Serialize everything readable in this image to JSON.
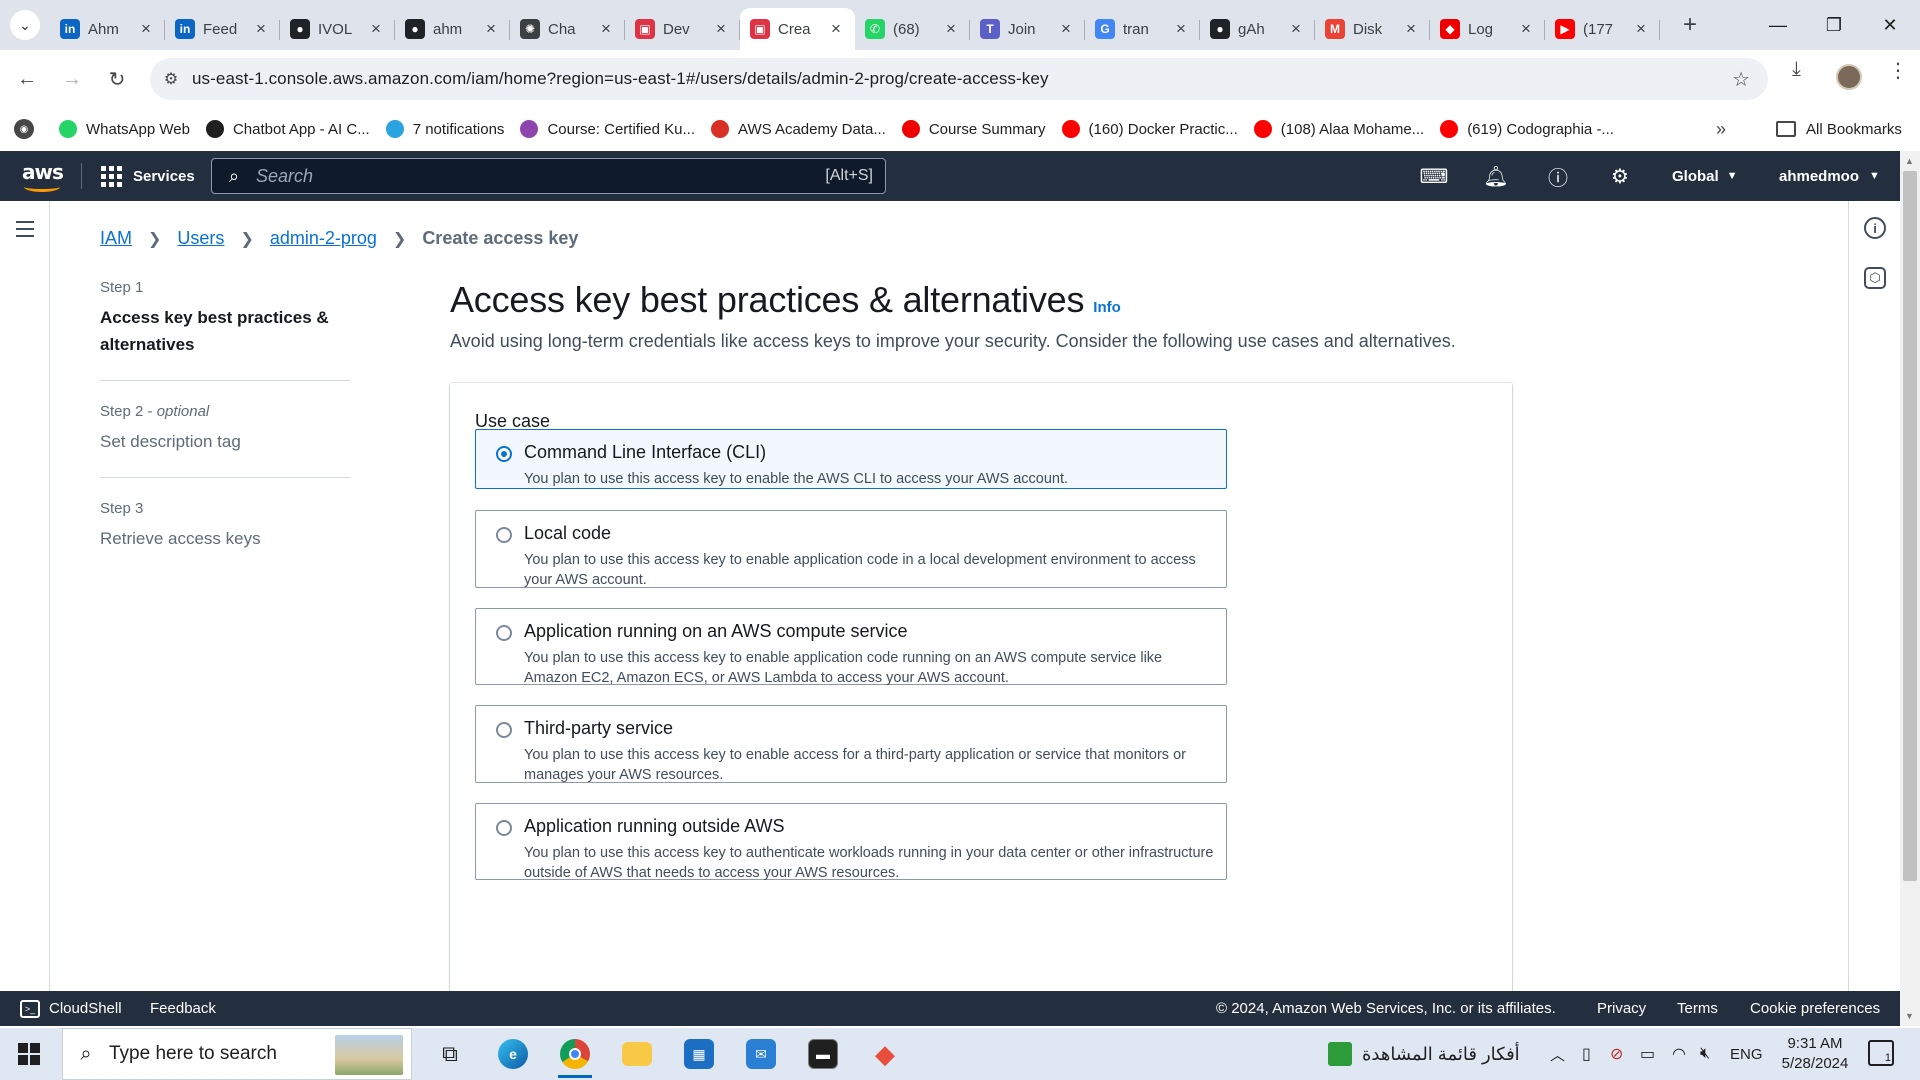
{
  "browser": {
    "tabs": [
      {
        "title": "Ahm",
        "favicon": "linkedin-icon",
        "color": "#0a66c2",
        "glyph": "in"
      },
      {
        "title": "Feed",
        "favicon": "linkedin-icon",
        "color": "#0a66c2",
        "glyph": "in"
      },
      {
        "title": "IVOL",
        "favicon": "github-icon",
        "color": "#1f2328",
        "glyph": "●"
      },
      {
        "title": "ahm",
        "favicon": "github-icon",
        "color": "#1f2328",
        "glyph": "●"
      },
      {
        "title": "Cha",
        "favicon": "openai-icon",
        "color": "#3c4043",
        "glyph": "✺"
      },
      {
        "title": "Dev",
        "favicon": "aws-icon",
        "color": "#dd3344",
        "glyph": "▣"
      },
      {
        "title": "Crea",
        "favicon": "aws-icon",
        "color": "#dd3344",
        "glyph": "▣",
        "active": true
      },
      {
        "title": "(68)",
        "favicon": "whatsapp-icon",
        "color": "#25d366",
        "glyph": "✆"
      },
      {
        "title": "Join",
        "favicon": "teams-icon",
        "color": "#5b5fc7",
        "glyph": "T"
      },
      {
        "title": "tran",
        "favicon": "google-icon",
        "color": "#4285f4",
        "glyph": "G"
      },
      {
        "title": "gAh",
        "favicon": "github-icon",
        "color": "#1f2328",
        "glyph": "●"
      },
      {
        "title": "Disk",
        "favicon": "gmail-icon",
        "color": "#ea4335",
        "glyph": "M"
      },
      {
        "title": "Log",
        "favicon": "redhat-icon",
        "color": "#ee0000",
        "glyph": "◆"
      },
      {
        "title": "(177",
        "favicon": "youtube-icon",
        "color": "#ff0000",
        "glyph": "▶"
      }
    ],
    "url": "us-east-1.console.aws.amazon.com/iam/home?region=us-east-1#/users/details/admin-2-prog/create-access-key",
    "bookmarks": [
      {
        "label": "WhatsApp Web",
        "icon": "whatsapp-icon",
        "color": "#25d366"
      },
      {
        "label": "Chatbot App - AI C...",
        "icon": "chatbot-icon",
        "color": "#1f1f1f"
      },
      {
        "label": "7 notifications",
        "icon": "telegram-icon",
        "color": "#2aa3df"
      },
      {
        "label": "Course: Certified Ku...",
        "icon": "course-icon",
        "color": "#8e44ad"
      },
      {
        "label": "AWS Academy Data...",
        "icon": "aws-academy-icon",
        "color": "#d93025"
      },
      {
        "label": "Course Summary",
        "icon": "redhat-icon",
        "color": "#ee0000"
      },
      {
        "label": "(160) Docker Practic...",
        "icon": "youtube-icon",
        "color": "#ff0000"
      },
      {
        "label": "(108) Alaa Mohame...",
        "icon": "youtube-icon",
        "color": "#ff0000"
      },
      {
        "label": "(619) Codographia -...",
        "icon": "youtube-icon",
        "color": "#ff0000"
      }
    ],
    "all_bookmarks": "All Bookmarks"
  },
  "aws": {
    "services_label": "Services",
    "search_placeholder": "Search",
    "search_shortcut": "[Alt+S]",
    "region": "Global",
    "account": "ahmedmoo",
    "breadcrumbs": [
      "IAM",
      "Users",
      "admin-2-prog"
    ],
    "breadcrumb_current": "Create access key",
    "steps": [
      {
        "num": "Step 1",
        "optional": "",
        "name": "Access key best practices & alternatives",
        "active": true
      },
      {
        "num": "Step 2",
        "optional": "optional",
        "name": "Set description tag",
        "active": false
      },
      {
        "num": "Step 3",
        "optional": "",
        "name": "Retrieve access keys",
        "active": false
      }
    ],
    "page_title": "Access key best practices & alternatives",
    "info_link": "Info",
    "subtitle": "Avoid using long-term credentials like access keys to improve your security. Consider the following use cases and alternatives.",
    "use_case_label": "Use case",
    "options": [
      {
        "title": "Command Line Interface (CLI)",
        "desc": "You plan to use this access key to enable the AWS CLI to access your AWS account.",
        "selected": true
      },
      {
        "title": "Local code",
        "desc": "You plan to use this access key to enable application code in a local development environment to access your AWS account.",
        "selected": false
      },
      {
        "title": "Application running on an AWS compute service",
        "desc": "You plan to use this access key to enable application code running on an AWS compute service like Amazon EC2, Amazon ECS, or AWS Lambda to access your AWS account.",
        "selected": false
      },
      {
        "title": "Third-party service",
        "desc": "You plan to use this access key to enable access for a third-party application or service that monitors or manages your AWS resources.",
        "selected": false
      },
      {
        "title": "Application running outside AWS",
        "desc": "You plan to use this access key to authenticate workloads running in your data center or other infrastructure outside of AWS that needs to access your AWS resources.",
        "selected": false
      }
    ],
    "footer": {
      "cloudshell": "CloudShell",
      "feedback": "Feedback",
      "copyright": "© 2024, Amazon Web Services, Inc. or its affiliates.",
      "privacy": "Privacy",
      "terms": "Terms",
      "cookies": "Cookie preferences"
    }
  },
  "taskbar": {
    "search_placeholder": "Type here to search",
    "widget_text": "أفكار قائمة المشاهدة",
    "language": "ENG",
    "time": "9:31 AM",
    "date": "5/28/2024",
    "notification_count": "1"
  }
}
